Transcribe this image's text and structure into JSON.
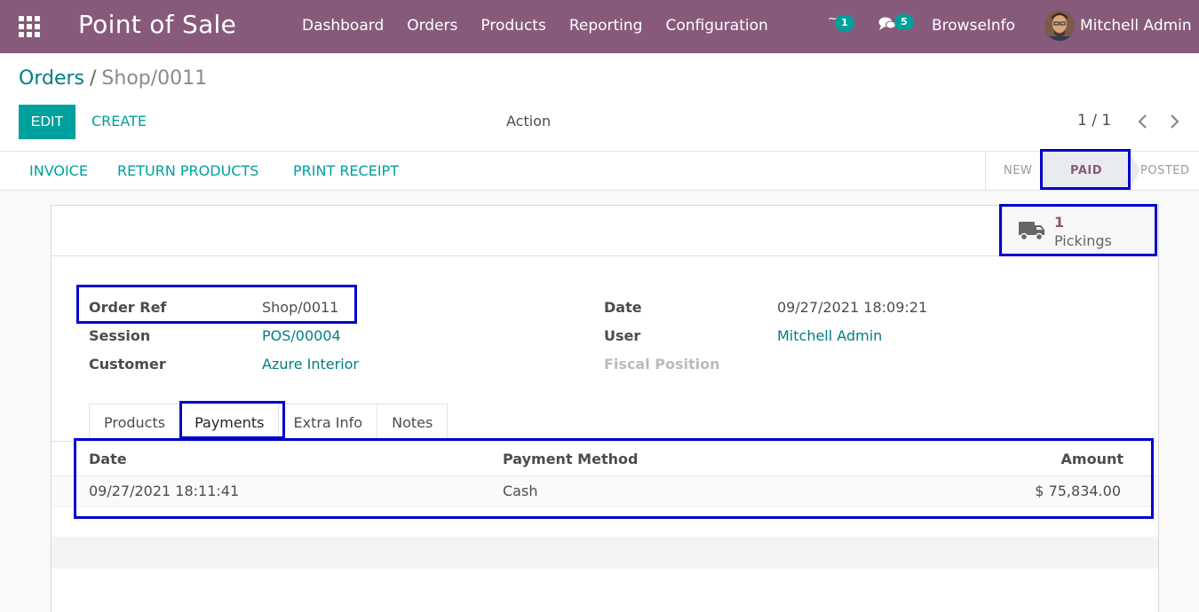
{
  "navbar": {
    "app_title": "Point of Sale",
    "menu": [
      "Dashboard",
      "Orders",
      "Products",
      "Reporting",
      "Configuration"
    ],
    "activity_badge": "1",
    "messages_badge": "5",
    "company": "BrowseInfo",
    "user": "Mitchell Admin"
  },
  "breadcrumb": {
    "parent": "Orders",
    "separator": "/",
    "current": "Shop/0011"
  },
  "toolbar": {
    "edit": "EDIT",
    "create": "CREATE",
    "action": "Action",
    "pager": "1 / 1"
  },
  "statusbar": {
    "buttons": [
      "INVOICE",
      "RETURN PRODUCTS",
      "PRINT RECEIPT"
    ],
    "stages": [
      "NEW",
      "PAID",
      "POSTED"
    ],
    "active_stage": "PAID"
  },
  "smart_button": {
    "value": "1",
    "label": "Pickings"
  },
  "fields": {
    "order_ref": {
      "label": "Order Ref",
      "value": "Shop/0011"
    },
    "session": {
      "label": "Session",
      "value": "POS/00004"
    },
    "customer": {
      "label": "Customer",
      "value": "Azure Interior"
    },
    "date": {
      "label": "Date",
      "value": "09/27/2021 18:09:21"
    },
    "user": {
      "label": "User",
      "value": "Mitchell Admin"
    },
    "fiscal_position": {
      "label": "Fiscal Position",
      "value": ""
    }
  },
  "tabs": [
    "Products",
    "Payments",
    "Extra Info",
    "Notes"
  ],
  "active_tab": "Payments",
  "payments": {
    "columns": [
      "Date",
      "Payment Method",
      "Amount"
    ],
    "rows": [
      {
        "date": "09/27/2021 18:11:41",
        "method": "Cash",
        "amount": "$ 75,834.00"
      }
    ]
  },
  "colors": {
    "brand": "#875a7b",
    "accent": "#00a09d",
    "link": "#017e84",
    "highlight": "#0000cc"
  }
}
